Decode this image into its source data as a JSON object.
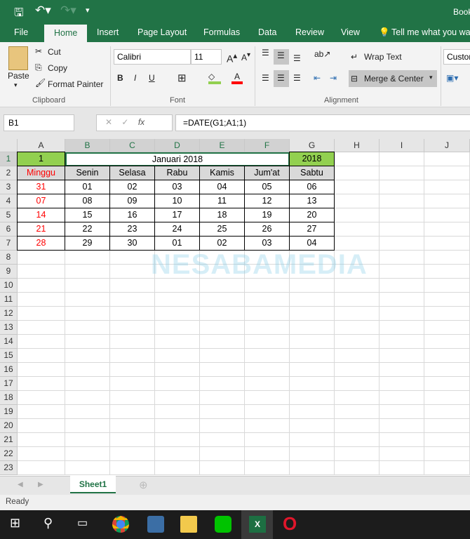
{
  "app": {
    "title": "Book"
  },
  "menu_tabs": [
    "File",
    "Home",
    "Insert",
    "Page Layout",
    "Formulas",
    "Data",
    "Review",
    "View"
  ],
  "tell_me": "Tell me what you want",
  "ribbon": {
    "paste": "Paste",
    "cut": "Cut",
    "copy": "Copy",
    "format_painter": "Format Painter",
    "clipboard": "Clipboard",
    "font_name": "Calibri",
    "font_size": "11",
    "bold": "B",
    "italic": "I",
    "underline": "U",
    "font": "Font",
    "wrap_text": "Wrap Text",
    "merge_center": "Merge & Center",
    "alignment": "Alignment",
    "number_format": "Custom"
  },
  "formula_bar": {
    "name_box": "B1",
    "formula": "=DATE(G1;A1;1)",
    "fx": "fx"
  },
  "columns": [
    "A",
    "B",
    "C",
    "D",
    "E",
    "F",
    "G",
    "H",
    "I",
    "J"
  ],
  "row_count": 23,
  "cells": {
    "A1": "1",
    "B1": "Januari 2018",
    "G1": "2018",
    "row2": [
      "Minggu",
      "Senin",
      "Selasa",
      "Rabu",
      "Kamis",
      "Jum'at",
      "Sabtu"
    ],
    "weeks": [
      [
        "31",
        "01",
        "02",
        "03",
        "04",
        "05",
        "06"
      ],
      [
        "07",
        "08",
        "09",
        "10",
        "11",
        "12",
        "13"
      ],
      [
        "14",
        "15",
        "16",
        "17",
        "18",
        "19",
        "20"
      ],
      [
        "21",
        "22",
        "23",
        "24",
        "25",
        "26",
        "27"
      ],
      [
        "28",
        "29",
        "30",
        "01",
        "02",
        "03",
        "04"
      ]
    ]
  },
  "colors": {
    "accent": "#217346",
    "header_fill": "#92d050",
    "sunday": "#ff0000",
    "day_header_fill": "#d9d9d9"
  },
  "watermark": "NESABAMEDIA",
  "sheets": [
    "Sheet1"
  ],
  "status": "Ready",
  "taskbar": [
    "windows-start",
    "search",
    "task-view",
    "chrome",
    "app",
    "file-explorer",
    "line",
    "excel",
    "opera"
  ]
}
